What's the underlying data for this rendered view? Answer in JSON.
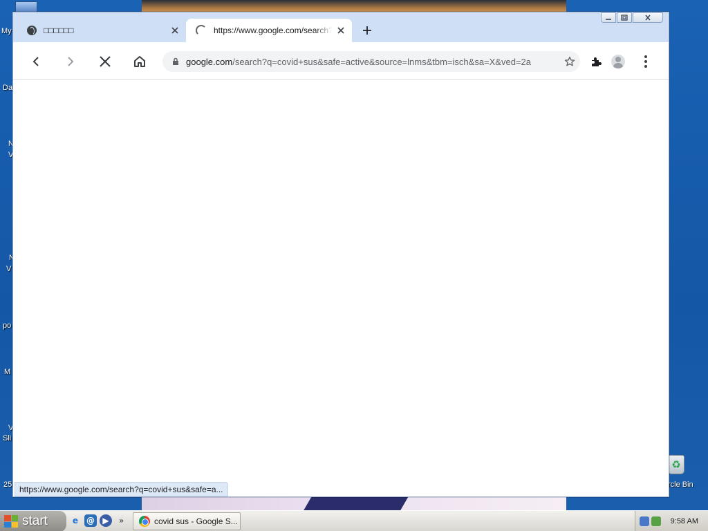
{
  "desktop": {
    "left_labels": [
      "My",
      "Da",
      "N",
      "V",
      "N",
      "V",
      "po",
      "M",
      "V",
      "Sli",
      "25"
    ],
    "recycle_bin_label": "rcle Bin",
    "recycle_symbol": "♻"
  },
  "browser": {
    "tabs": [
      {
        "title": "□□□□□□",
        "icon": "globe-icon",
        "close": "✕"
      },
      {
        "title": "https://www.google.com/search?q=covid+sus",
        "icon": "loading-spinner-icon",
        "close": "✕",
        "active": true
      }
    ],
    "new_tab": "+",
    "caption": {
      "minimize": "—",
      "maximize": "□",
      "close": "✕"
    },
    "toolbar": {
      "back": "back-icon",
      "forward": "forward-icon",
      "stop": "stop-icon",
      "home": "home-icon"
    },
    "omnibox": {
      "host": "google.com",
      "path": "/search?q=covid+sus&safe=active&source=lnms&tbm=isch&sa=X&ved=2a"
    },
    "status_url": "https://www.google.com/search?q=covid+sus&safe=a..."
  },
  "taskbar": {
    "start_label": "start",
    "quick_launch": [
      {
        "name": "ie-icon",
        "glyph": "e",
        "color": "#1f73d6"
      },
      {
        "name": "outlook-icon",
        "glyph": "@",
        "color": "#2a6fb8"
      },
      {
        "name": "media-player-icon",
        "glyph": "▶",
        "color": "#3a5da8"
      }
    ],
    "chevron": "»",
    "task_button_label": "covid sus - Google S...",
    "clock": "9:58 AM"
  }
}
